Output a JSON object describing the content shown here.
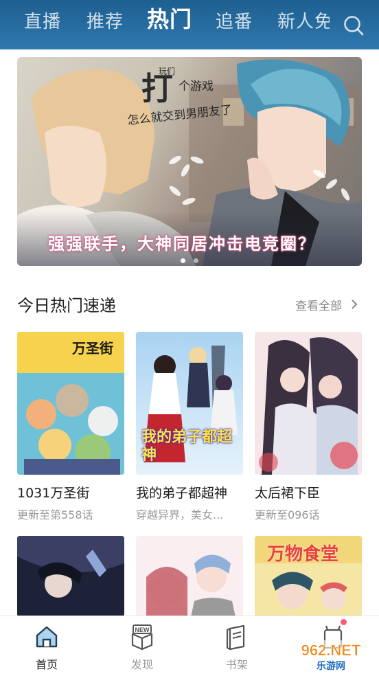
{
  "tabs": [
    {
      "label": "直播",
      "active": false
    },
    {
      "label": "推荐",
      "active": false
    },
    {
      "label": "热门",
      "active": true
    },
    {
      "label": "追番",
      "active": false
    },
    {
      "label": "新人免",
      "active": false
    }
  ],
  "banner": {
    "title_big": "打",
    "title_small": "个游戏",
    "title_tiny": "玩们",
    "title_line2": "怎么就交到男朋友了",
    "caption": "强强联手，大神同居冲击电竞圈？",
    "dot_count": 2,
    "active_dot": 0
  },
  "section": {
    "title": "今日热门速递",
    "see_all": "查看全部"
  },
  "cards": [
    {
      "title": "1031万圣街",
      "subtitle": "更新至第558话",
      "cover_text": "万圣街"
    },
    {
      "title": "我的弟子都超神",
      "subtitle": "穿越异界，美女...",
      "cover_text": "我的弟子都超神"
    },
    {
      "title": "太后裙下臣",
      "subtitle": "更新至096话",
      "cover_text": ""
    },
    {
      "title": "",
      "subtitle": "",
      "cover_text": ""
    },
    {
      "title": "",
      "subtitle": "",
      "cover_text": ""
    },
    {
      "title": "",
      "subtitle": "",
      "cover_text": "万物食堂"
    }
  ],
  "bottom_nav": [
    {
      "label": "首页",
      "icon": "home-icon",
      "active": true
    },
    {
      "label": "发现",
      "icon": "new-box-icon",
      "active": false
    },
    {
      "label": "书架",
      "icon": "bookshelf-icon",
      "active": false
    },
    {
      "label": "",
      "icon": "profile-icon",
      "active": false
    }
  ],
  "watermark": {
    "line1": "962.NET",
    "line2": "乐游网"
  },
  "colors": {
    "topbar": "#2a6ea3",
    "accent_red": "#ff5a78",
    "nav_active": "#3a8fd6"
  }
}
